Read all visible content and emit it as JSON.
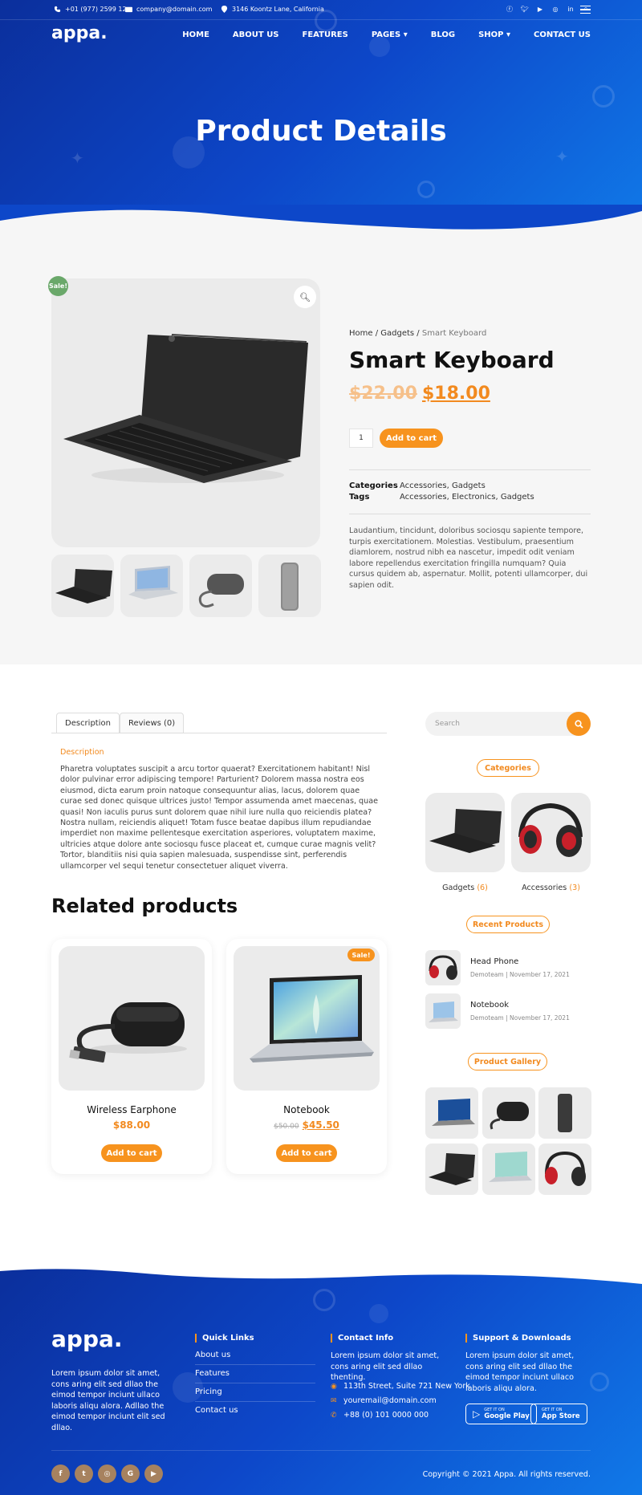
{
  "topbar": {
    "phone": "+01 (977) 2599 12",
    "email": "company@domain.com",
    "address": "3146 Koontz Lane, California",
    "social": [
      "facebook-icon",
      "twitter-icon",
      "youtube-icon",
      "instagram-icon",
      "linkedin-icon",
      "search-icon",
      "menu-icon"
    ]
  },
  "brand": {
    "logo": "appa."
  },
  "nav": {
    "items": [
      "HOME",
      "ABOUT US",
      "FEATURES",
      "PAGES",
      "BLOG",
      "SHOP",
      "CONTACT US"
    ]
  },
  "hero": {
    "title": "Product Details"
  },
  "product": {
    "sale_badge": "Sale!",
    "breadcrumb": {
      "home": "Home",
      "sep1": " / ",
      "category": "Gadgets",
      "sep2": " / ",
      "current": "Smart Keyboard"
    },
    "title": "Smart Keyboard",
    "old_price": "$22.00",
    "new_price": "$18.00",
    "quantity": "1",
    "add_to_cart": "Add to cart",
    "categories_label": "Categories",
    "categories_value": "Accessories, Gadgets",
    "tags_label": "Tags",
    "tags_value": "Accessories, Electronics, Gadgets",
    "description": "Laudantium, tincidunt, doloribus sociosqu sapiente tempore, turpis exercitationem. Molestias. Vestibulum, praesentium diamlorem, nostrud nibh ea nascetur, impedit odit veniam labore repellendus exercitation fringilla numquam? Quia cursus quidem ab, aspernatur. Mollit, potenti ullamcorper, dui sapien odit."
  },
  "tabs": {
    "items": [
      "Description",
      "Reviews (0)"
    ],
    "description_heading": "Description",
    "description_body": "Pharetra voluptates suscipit a arcu tortor quaerat? Exercitationem habitant! Nisl dolor pulvinar error adipiscing tempore! Parturient? Dolorem massa nostra eos eiusmod, dicta earum proin natoque consequuntur alias, lacus, dolorem quae curae sed donec quisque ultrices justo! Tempor assumenda amet maecenas, quae quasi! Non iaculis purus sunt dolorem quae nihil iure nulla quo reiciendis platea? Nostra nullam, reiciendis aliquet! Totam fusce beatae dapibus illum repudiandae imperdiet non maxime pellentesque exercitation asperiores, voluptatem maxime, ultricies atque dolore ante sociosqu fusce placeat et, cumque curae magnis velit? Tortor, blanditiis nisi quia sapien malesuada, suspendisse sint, perferendis ullamcorper vel sequi tenetur consectetuer aliquet viverra."
  },
  "related": {
    "heading": "Related products",
    "items": [
      {
        "name": "Wireless Earphone",
        "old_price": "",
        "price": "$88.00",
        "button": "Add to cart"
      },
      {
        "name": "Notebook",
        "old_price": "$50.00",
        "price": "$45.50",
        "button": "Add to cart",
        "badge": "Sale!"
      }
    ]
  },
  "sidebar": {
    "search_placeholder": "Search",
    "categories_title": "Categories",
    "categories": [
      {
        "name": "Gadgets ",
        "count": "(6)"
      },
      {
        "name": "Accessories ",
        "count": "(3)"
      }
    ],
    "recent_title": "Recent Products",
    "recent": [
      {
        "name": "Head Phone",
        "meta": "Demoteam | November 17, 2021"
      },
      {
        "name": "Notebook",
        "meta": "Demoteam | November 17, 2021"
      }
    ],
    "gallery_title": "Product Gallery"
  },
  "footer": {
    "logo": "appa.",
    "about": "Lorem ipsum dolor sit amet, cons aring elit sed dllao the eimod tempor inciunt ullaco laboris aliqu alora. Adllao the eimod tempor inciunt elit sed dllao.",
    "quick_links_title": "Quick Links",
    "quick_links": [
      "About us",
      "Features",
      "Pricing",
      "Contact us"
    ],
    "contact_title": "Contact Info",
    "contact_text": "Lorem ipsum dolor sit amet, cons aring elit sed dllao thenting.",
    "address": "113th Street, Suite 721 New York",
    "email": "youremail@domain.com",
    "phone": "+88 (0) 101 0000 000",
    "support_title": "Support & Downloads",
    "support_text": "Lorem ipsum dolor sit amet, cons aring elit sed dllao the eimod tempor inciunt ullaco laboris aliqu alora.",
    "google_small": "GET IT ON",
    "google_big": "Google Play",
    "apple_small": "GET IT ON",
    "apple_big": "App Store",
    "social": [
      "facebook-icon",
      "twitter-icon",
      "instagram-icon",
      "google-icon",
      "youtube-icon"
    ],
    "social_glyphs": [
      "f",
      "t",
      "◎",
      "G",
      "▶"
    ],
    "copyright": "Copyright © 2021 Appa. All rights reserved."
  }
}
